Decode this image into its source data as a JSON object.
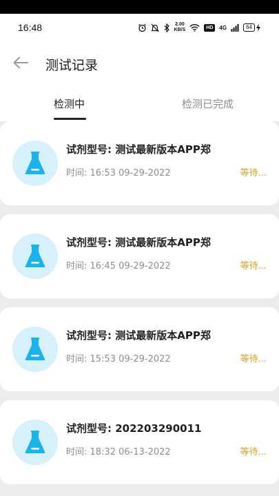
{
  "status_bar": {
    "time": "16:48",
    "speed_value": "2.00",
    "speed_unit": "KB/S",
    "hd_label": "HD",
    "signal_label": "4G",
    "battery_level": "64",
    "icons": [
      "alarm-icon",
      "mute-icon",
      "bluetooth-icon",
      "wifi-icon",
      "signal-icon",
      "battery-icon",
      "charging-icon"
    ]
  },
  "header": {
    "title": "测试记录"
  },
  "tabs": [
    {
      "label": "检测中",
      "active": true
    },
    {
      "label": "检测已完成",
      "active": false
    }
  ],
  "colors": {
    "accent_icon": "#19b3f0",
    "icon_bg": "#d6f1fb",
    "status_pending": "#d9a21f",
    "page_bg": "#ececec"
  },
  "records": [
    {
      "title": "试剂型号: 测试最新版本APP郑",
      "time": "时间: 16:53 09-29-2022",
      "status": "等待..."
    },
    {
      "title": "试剂型号: 测试最新版本APP郑",
      "time": "时间: 16:45 09-29-2022",
      "status": "等待..."
    },
    {
      "title": "试剂型号: 测试最新版本APP郑",
      "time": "时间: 15:53 09-29-2022",
      "status": "等待..."
    },
    {
      "title": "试剂型号: 202203290011",
      "time": "时间: 18:32 06-13-2022",
      "status": "等待..."
    }
  ]
}
